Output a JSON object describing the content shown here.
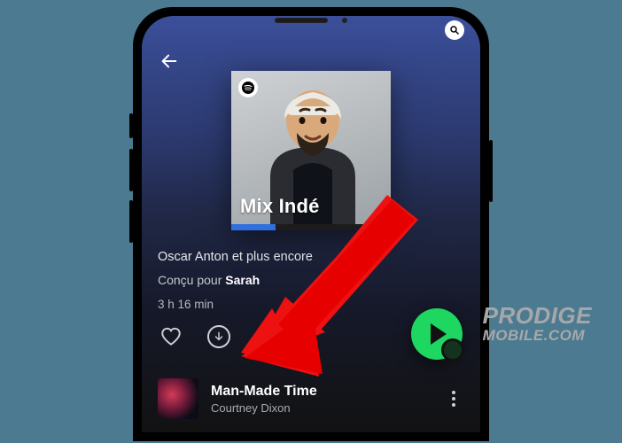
{
  "cover": {
    "title": "Mix Indé",
    "spotify_icon": "spotify-icon"
  },
  "playlist": {
    "byline": "Oscar Anton et plus encore",
    "made_for_prefix": "Conçu pour ",
    "made_for_user": "Sarah",
    "duration": "3 h 16 min"
  },
  "track": {
    "title": "Man-Made Time",
    "artist": "Courtney Dixon"
  },
  "watermark": {
    "line1": "PRODIGE",
    "line2": "MOBILE.COM"
  }
}
